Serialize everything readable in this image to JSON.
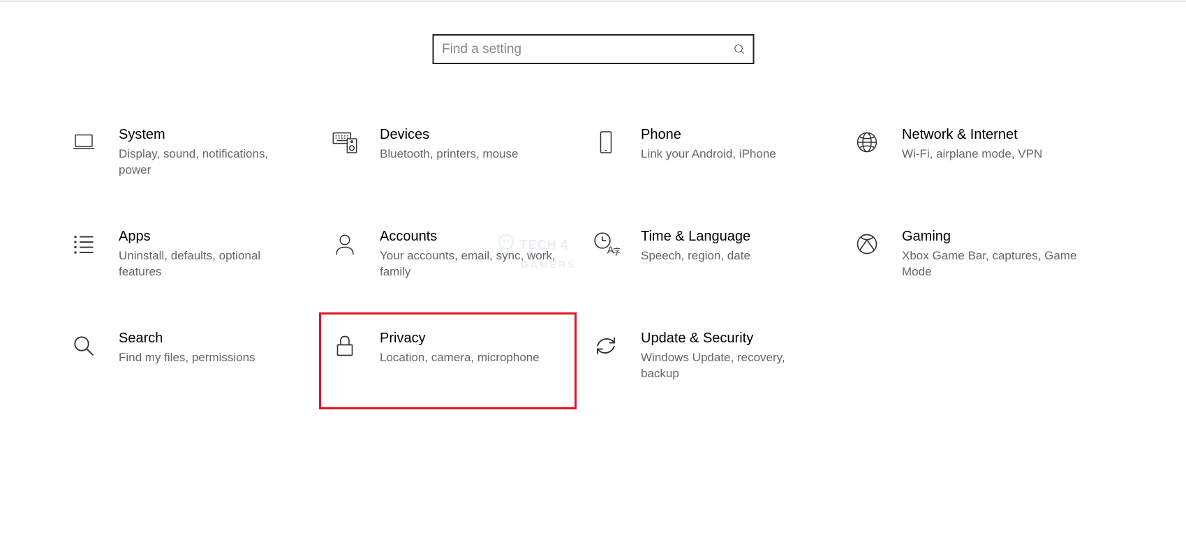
{
  "search": {
    "placeholder": "Find a setting"
  },
  "tiles": [
    {
      "title": "System",
      "desc": "Display, sound, notifications, power",
      "icon": "laptop-icon"
    },
    {
      "title": "Devices",
      "desc": "Bluetooth, printers, mouse",
      "icon": "keyboard-speaker-icon"
    },
    {
      "title": "Phone",
      "desc": "Link your Android, iPhone",
      "icon": "phone-icon"
    },
    {
      "title": "Network & Internet",
      "desc": "Wi-Fi, airplane mode, VPN",
      "icon": "globe-icon"
    },
    {
      "title": "Apps",
      "desc": "Uninstall, defaults, optional features",
      "icon": "apps-list-icon"
    },
    {
      "title": "Accounts",
      "desc": "Your accounts, email, sync, work, family",
      "icon": "person-icon"
    },
    {
      "title": "Time & Language",
      "desc": "Speech, region, date",
      "icon": "time-language-icon"
    },
    {
      "title": "Gaming",
      "desc": "Xbox Game Bar, captures, Game Mode",
      "icon": "xbox-icon"
    },
    {
      "title": "Search",
      "desc": "Find my files, permissions",
      "icon": "magnifier-icon"
    },
    {
      "title": "Privacy",
      "desc": "Location, camera, microphone",
      "icon": "lock-icon",
      "highlighted": true
    },
    {
      "title": "Update & Security",
      "desc": "Windows Update, recovery, backup",
      "icon": "sync-icon"
    }
  ],
  "watermark": {
    "line1": "TECH 4",
    "line2": "GAMERS"
  }
}
